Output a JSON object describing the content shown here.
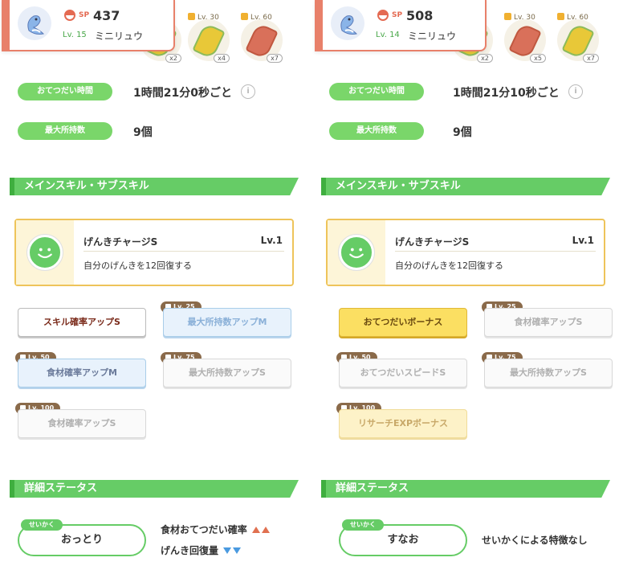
{
  "left": {
    "header": {
      "sp_label": "SP",
      "sp_value": "437",
      "level": "Lv. 15",
      "name": "ミニリュウ"
    },
    "ingredients": [
      {
        "lock": "",
        "count": "x2",
        "kind": "corn"
      },
      {
        "lock": "Lv. 30",
        "count": "x4",
        "kind": "corn"
      },
      {
        "lock": "Lv. 60",
        "count": "x7",
        "kind": "leaf"
      }
    ],
    "help_time_label": "おてつだい時間",
    "help_time_value": "1時間21分0秒ごと",
    "info_icon": "i",
    "max_carry_label": "最大所持数",
    "max_carry_value": "9個",
    "skills_header": "メインスキル・サブスキル",
    "main_skill": {
      "name": "げんきチャージS",
      "level": "Lv.1",
      "desc": "自分のげんきを12回復する"
    },
    "subs": [
      {
        "lock": "",
        "label": "スキル確率アップS"
      },
      {
        "lock": "Lv. 25",
        "label": "最大所持数アップM"
      },
      {
        "lock": "Lv. 50",
        "label": "食材確率アップM"
      },
      {
        "lock": "Lv. 75",
        "label": "最大所持数アップS"
      },
      {
        "lock": "Lv. 100",
        "label": "食材確率アップS"
      }
    ],
    "detail_header": "詳細ステータス",
    "nature_tag": "せいかく",
    "nature": "おっとり",
    "effects": [
      "食材おてつだい確率",
      "げんき回復量"
    ]
  },
  "right": {
    "header": {
      "sp_label": "SP",
      "sp_value": "508",
      "level": "Lv. 14",
      "name": "ミニリュウ"
    },
    "ingredients": [
      {
        "lock": "",
        "count": "x2",
        "kind": "corn"
      },
      {
        "lock": "Lv. 30",
        "count": "x5",
        "kind": "leaf"
      },
      {
        "lock": "Lv. 60",
        "count": "x7",
        "kind": "corn"
      }
    ],
    "help_time_label": "おてつだい時間",
    "help_time_value": "1時間21分10秒ごと",
    "info_icon": "i",
    "max_carry_label": "最大所持数",
    "max_carry_value": "9個",
    "skills_header": "メインスキル・サブスキル",
    "main_skill": {
      "name": "げんきチャージS",
      "level": "Lv.1",
      "desc": "自分のげんきを12回復する"
    },
    "subs": [
      {
        "lock": "",
        "label": "おてつだいボーナス"
      },
      {
        "lock": "Lv. 25",
        "label": "食材確率アップS"
      },
      {
        "lock": "Lv. 50",
        "label": "おてつだいスピードS"
      },
      {
        "lock": "Lv. 75",
        "label": "最大所持数アップS"
      },
      {
        "lock": "Lv. 100",
        "label": "リサーチEXPボーナス"
      }
    ],
    "detail_header": "詳細ステータス",
    "nature_tag": "せいかく",
    "nature": "すなお",
    "effects": [
      "せいかくによる特徴なし"
    ]
  }
}
